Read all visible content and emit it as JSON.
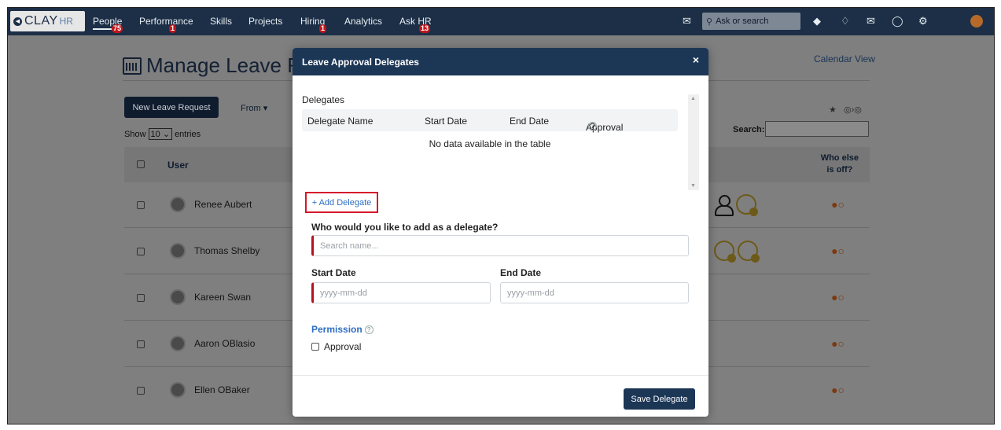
{
  "app": {
    "brand_a": "CLAY",
    "brand_b": "HR"
  },
  "nav": {
    "items": [
      {
        "label": "People",
        "badge": "75"
      },
      {
        "label": "Performance",
        "badge": "1"
      },
      {
        "label": "Skills",
        "badge": ""
      },
      {
        "label": "Projects",
        "badge": ""
      },
      {
        "label": "Hiring",
        "badge": "1"
      },
      {
        "label": "Analytics",
        "badge": ""
      },
      {
        "label": "Ask HR",
        "badge": "13"
      }
    ],
    "search_placeholder": "Ask or search"
  },
  "page": {
    "title": "Manage Leave Re",
    "calendar_view": "Calendar View",
    "new_request": "New Leave Request",
    "from": "From ▾",
    "show": "Show",
    "entries_value": "10",
    "entries": "entries",
    "search_label": "Search:",
    "col_user": "User",
    "col_who_else_1": "Who else",
    "col_who_else_2": "is off?",
    "users": [
      {
        "name": "Renee Aubert"
      },
      {
        "name": "Thomas Shelby"
      },
      {
        "name": "Kareen Swan"
      },
      {
        "name": "Aaron OBlasio"
      },
      {
        "name": "Ellen OBaker"
      }
    ]
  },
  "modal": {
    "title": "Leave Approval Delegates",
    "close": "×",
    "delegates_label": "Delegates",
    "columns": [
      "Delegate Name",
      "Start Date",
      "End Date",
      "Approval"
    ],
    "no_data": "No data available in the table",
    "add_delegate": "+ Add Delegate",
    "question": "Who would you like to add as a delegate?",
    "search_placeholder": "Search name...",
    "start_date_label": "Start Date",
    "end_date_label": "End Date",
    "date_placeholder": "yyyy-mm-dd",
    "permission_label": "Permission",
    "approval_label": "Approval",
    "save": "Save Delegate"
  },
  "colors": {
    "nav_bg": "#1c2f47",
    "modal_header": "#1c3656",
    "accent_red": "#d5172b",
    "link_blue": "#2d6ec2"
  }
}
